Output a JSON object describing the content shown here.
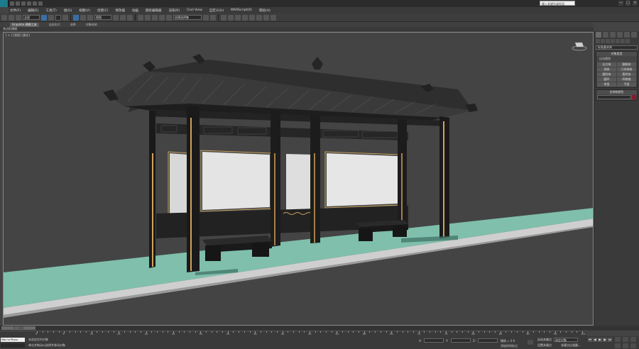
{
  "title_bar": {
    "search_placeholder": "键入关键字或短语",
    "min": "—",
    "max": "□",
    "close": "×"
  },
  "menu": [
    "文件(F)",
    "编辑(E)",
    "工具(T)",
    "组(G)",
    "视图(V)",
    "创建(C)",
    "修改器",
    "动画",
    "图形编辑器",
    "渲染(R)",
    "Civil View",
    "自定义(U)",
    "MAXScript(X)",
    "帮助(H)"
  ],
  "toolbar": {
    "filter_select": "全部",
    "view_select": "视图",
    "selection_set": "创建选择集"
  },
  "ribbon": {
    "tabs": [
      "Graphite 建模工具",
      "自由形式",
      "选择",
      "对象绘制"
    ],
    "sub_label": "多边形建模"
  },
  "viewport": {
    "label": "[ + ] [透视] [真实]"
  },
  "command_panel": {
    "category_select": "标准基本体",
    "object_type_header": "对象类型",
    "autogrid_label": "自动栅格",
    "objects": [
      "长方体",
      "圆锥体",
      "球体",
      "几何球体",
      "圆柱体",
      "管状体",
      "圆环",
      "四棱锥",
      "茶壶",
      "平面"
    ],
    "name_color_header": "名称和颜色",
    "color": "#8a1a2b"
  },
  "timeline": {
    "frame": "0 / 100",
    "ticks": [
      "0",
      "5",
      "10",
      "15",
      "20",
      "25",
      "30",
      "35",
      "40",
      "45",
      "50",
      "55",
      "60",
      "65",
      "70",
      "75",
      "80",
      "85",
      "90",
      "95",
      "100"
    ]
  },
  "status": {
    "maxscript_label": "Max to Physc.",
    "line1": "未选定任何对象",
    "line2": "单击并拖动以选择并移动对象",
    "x_label": "X:",
    "y_label": "Y:",
    "z_label": "Z:",
    "grid_label": "栅格 = 0.0",
    "add_time_tag": "添加时间标记",
    "auto_key": "自动关键点",
    "set_key": "设置关键点",
    "selected_obj": "选定对象",
    "key_filter": "关键点过滤器..."
  }
}
